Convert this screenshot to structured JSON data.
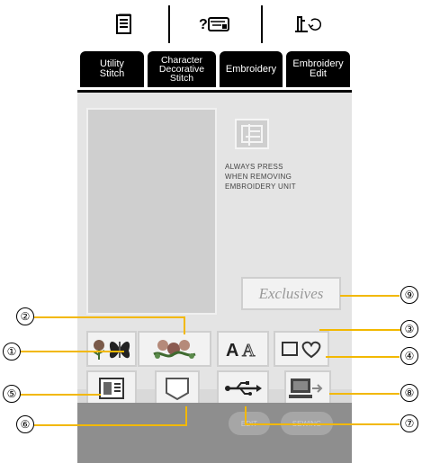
{
  "top_icons": [
    {
      "icon": "manual-book-icon"
    },
    {
      "icon": "help-machine-icon"
    },
    {
      "icon": "needle-settings-icon"
    }
  ],
  "tabs": [
    {
      "label_lines": [
        "Utility",
        "Stitch"
      ]
    },
    {
      "label_lines": [
        "Character",
        "Decorative",
        "Stitch"
      ]
    },
    {
      "label_lines": [
        "Embroidery"
      ]
    },
    {
      "label_lines": [
        "Embroidery",
        "Edit"
      ]
    }
  ],
  "notice": {
    "lines": [
      "ALWAYS PRESS",
      "WHEN REMOVING",
      "EMBROIDERY UNIT"
    ]
  },
  "exclusives_label": "Exclusives",
  "pattern_buttons": [
    {
      "icon": "flower-butterfly-icon"
    },
    {
      "icon": "floral-pattern-icon"
    },
    {
      "icon": "alphabet-font-icon"
    },
    {
      "icon": "frame-shapes-icon"
    },
    {
      "icon": "memory-pocket-icon"
    },
    {
      "icon": "pocket-icon"
    },
    {
      "icon": "usb-icon"
    },
    {
      "icon": "computer-icon"
    }
  ],
  "bottom_buttons": {
    "edit": "EDIT",
    "sewing": "SEWING"
  },
  "callouts": [
    "①",
    "②",
    "③",
    "④",
    "⑤",
    "⑥",
    "⑦",
    "⑧",
    "⑨"
  ],
  "colors": {
    "tab_bg": "#000000",
    "leader_line": "#f2b800",
    "screen_bg": "#d9d9d9"
  }
}
